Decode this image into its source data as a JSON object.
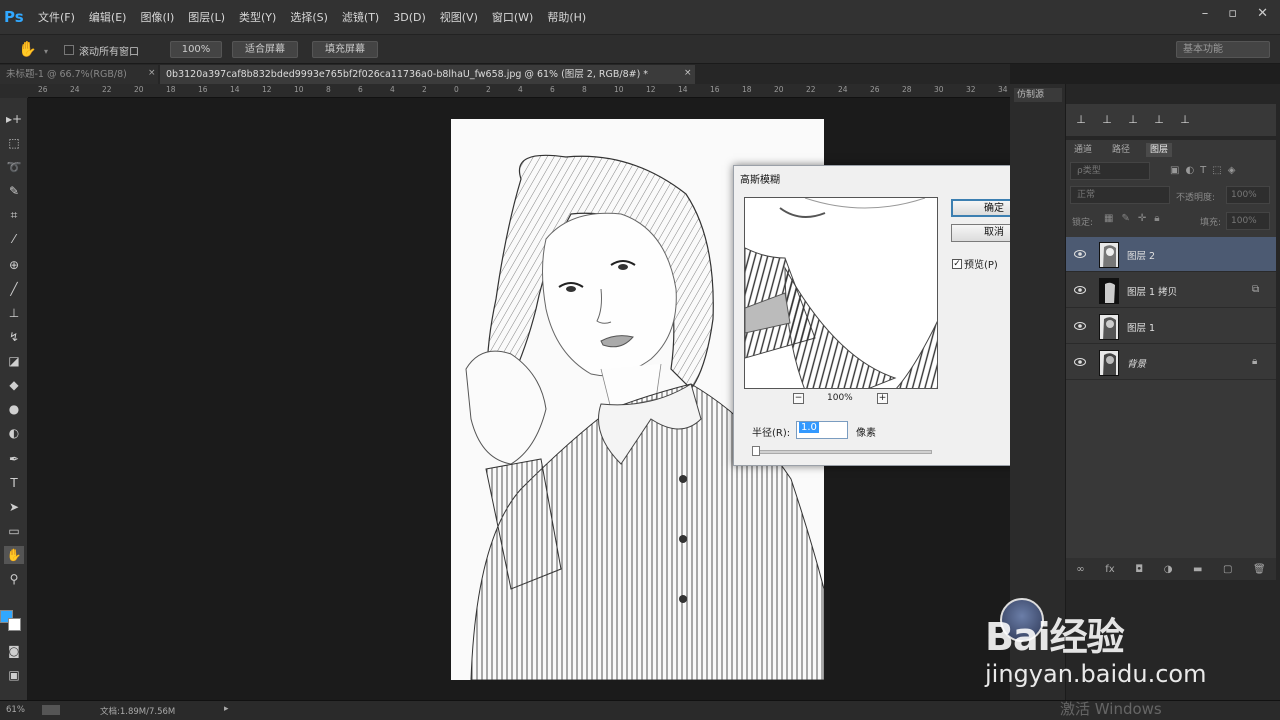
{
  "app": {
    "logo": "Ps"
  },
  "menu": [
    "文件(F)",
    "编辑(E)",
    "图像(I)",
    "图层(L)",
    "类型(Y)",
    "选择(S)",
    "滤镜(T)",
    "3D(D)",
    "视图(V)",
    "窗口(W)",
    "帮助(H)"
  ],
  "options": {
    "scroll_all_label": "滚动所有窗口",
    "zoom100_label": "100%",
    "fit_screen_label": "适合屏幕",
    "fill_screen_label": "填充屏幕",
    "workspace": "基本功能"
  },
  "tabs": [
    {
      "label": "未标题-1 @ 66.7%(RGB/8)",
      "close": "×"
    },
    {
      "label": "0b3120a397caf8b832bded9993e765bf2f026ca11736a0-b8lhaU_fw658.jpg @ 61% (图层 2, RGB/8#) *",
      "close": "×"
    }
  ],
  "ruler_ticks": [
    "26",
    "24",
    "22",
    "20",
    "18",
    "16",
    "14",
    "12",
    "10",
    "8",
    "6",
    "4",
    "2",
    "0",
    "2",
    "4",
    "6",
    "8",
    "10",
    "12",
    "14",
    "16",
    "18",
    "20",
    "22",
    "24",
    "26",
    "28",
    "30",
    "32",
    "34"
  ],
  "dialog": {
    "title": "高斯模糊",
    "ok": "确定",
    "cancel": "取消",
    "preview_label": "预览(P)",
    "zoom": "100%",
    "radius_label": "半径(R):",
    "radius_value": "1.0",
    "unit": "像素"
  },
  "clone_panel": {
    "title": "仿制源"
  },
  "layers_panel": {
    "tabs": [
      "通道",
      "路径",
      "图层"
    ],
    "filter_placeholder": "ρ类型",
    "blend_mode": "正常",
    "opacity_label": "不透明度:",
    "opacity_value": "100%",
    "lock_label": "锁定:",
    "fill_label": "填充:",
    "fill_value": "100%",
    "layers": [
      {
        "name": "图层 2",
        "selected": true
      },
      {
        "name": "图层 1 拷贝",
        "selected": false
      },
      {
        "name": "图层 1",
        "selected": false
      },
      {
        "name": "背景",
        "selected": false
      }
    ]
  },
  "status": {
    "zoom": "61%",
    "doc": "文档:1.89M/7.56M"
  },
  "watermark": {
    "logo": "Bai经验",
    "url": "jingyan.baidu.com",
    "activation": "激活 Windows"
  },
  "colors": {
    "accent": "#31a8ff",
    "selected_layer": "#4c5a72",
    "dialog_bg": "#f0f0f0"
  }
}
